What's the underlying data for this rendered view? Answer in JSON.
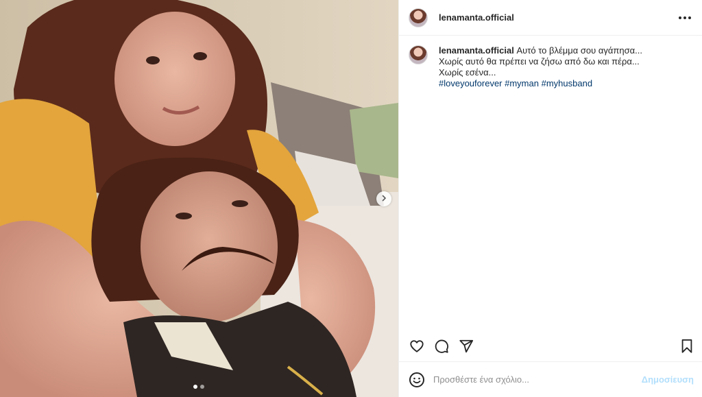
{
  "post": {
    "username": "lenamanta.official",
    "caption_lines": [
      "Αυτό το βλέμμα σου αγάπησα...",
      "Χωρίς αυτό θα πρέπει να ζήσω από δω και πέρα...",
      "Χωρίς εσένα..."
    ],
    "hashtags": [
      "#loveyouforever",
      "#myman",
      "#myhusband"
    ],
    "media_description_icon": "photo",
    "carousel": {
      "total": 2,
      "current": 1
    }
  },
  "icons": {
    "more": "more-horizontal-icon",
    "next": "chevron-right-icon",
    "like": "heart-outline-icon",
    "comment": "comment-bubble-icon",
    "share": "paper-plane-icon",
    "save": "bookmark-outline-icon",
    "emoji": "emoji-smile-icon"
  },
  "comment_box": {
    "placeholder": "Προσθέστε ένα σχόλιο...",
    "submit_label": "Δημοσίευση"
  },
  "colors": {
    "link": "#00376b",
    "submit_disabled": "#b2dffc",
    "border": "#efefef"
  }
}
